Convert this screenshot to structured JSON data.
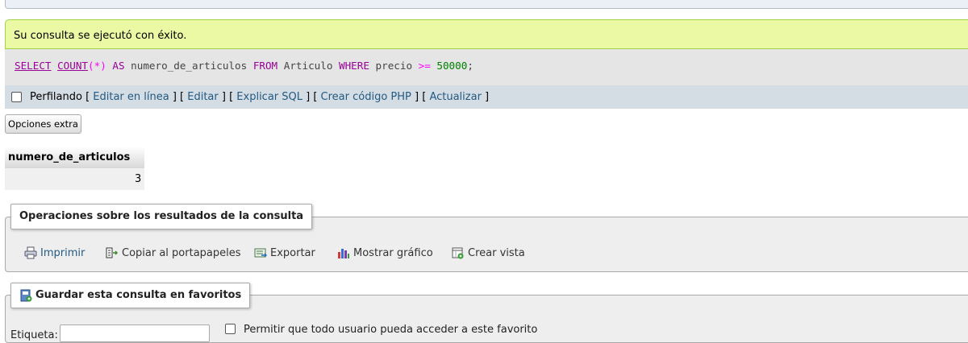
{
  "success_message": "Su consulta se ejecutó con éxito.",
  "sql": {
    "select": "SELECT",
    "count": "COUNT",
    "open_paren": "(",
    "star": "*",
    "close_paren": ")",
    "as": "AS",
    "alias": "numero_de_articulos",
    "from": "FROM",
    "table": "Articulo",
    "where": "WHERE",
    "column": "precio",
    "operator": ">=",
    "value": "50000",
    "terminator": ";"
  },
  "query_tools": {
    "profiling_label": "Perfilando",
    "links": [
      "Editar en línea",
      "Editar",
      "Explicar SQL",
      "Crear código PHP",
      "Actualizar"
    ]
  },
  "extra_options_label": "Opciones extra",
  "result": {
    "columns": [
      "numero_de_articulos"
    ],
    "rows": [
      [
        "3"
      ]
    ]
  },
  "operations": {
    "legend": "Operaciones sobre los resultados de la consulta",
    "items": [
      {
        "label": "Imprimir",
        "icon": "printer-icon",
        "link": true
      },
      {
        "label": "Copiar al portapapeles",
        "icon": "clipboard-icon",
        "link": false
      },
      {
        "label": "Exportar",
        "icon": "export-icon",
        "link": false
      },
      {
        "label": "Mostrar gráfico",
        "icon": "chart-icon",
        "link": false
      },
      {
        "label": "Crear vista",
        "icon": "view-icon",
        "link": false
      }
    ]
  },
  "bookmark": {
    "legend": "Guardar esta consulta en favoritos",
    "label_field": "Etiqueta:",
    "label_value": "",
    "allow_all_users": "Permitir que todo usuario pueda acceder a este favorito"
  }
}
